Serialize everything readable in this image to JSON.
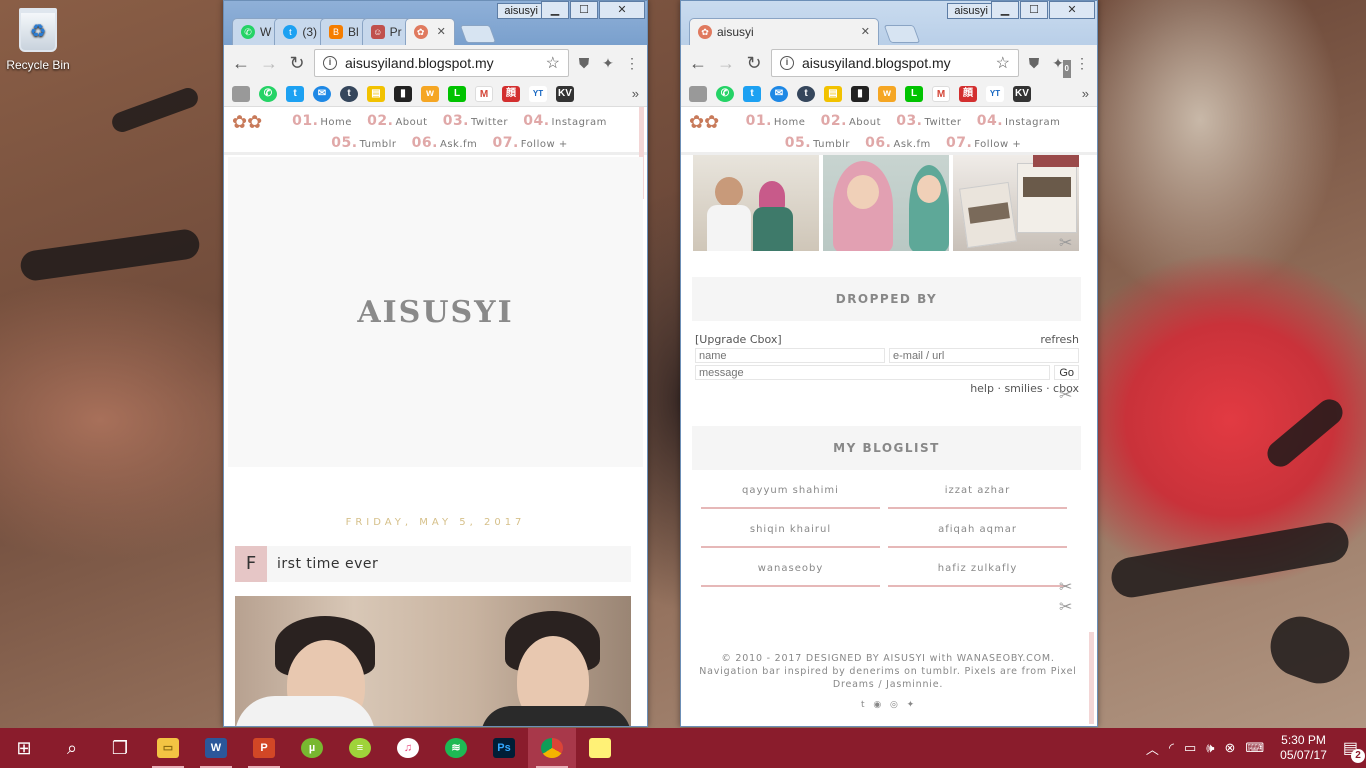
{
  "desktop": {
    "recycle_bin_label": "Recycle Bin"
  },
  "window1": {
    "profile": "aisusyi",
    "tabs": [
      {
        "label": "W",
        "icon": "whatsapp-icon",
        "color": "#25d366"
      },
      {
        "label": "(3)",
        "icon": "twitter-icon",
        "color": "#1da1f2"
      },
      {
        "label": "Bl",
        "icon": "blogger-icon",
        "color": "#f57d00"
      },
      {
        "label": "Pr",
        "icon": "profile-icon",
        "color": "#c0504d"
      },
      {
        "label": "",
        "icon": "flower-icon",
        "color": "#e07a5f"
      }
    ],
    "url": "aisusyiland.blogspot.my"
  },
  "window2": {
    "profile": "aisusyi",
    "tab_label": "aisusyi",
    "url": "aisusyiland.blogspot.my",
    "ext_badge": "0"
  },
  "blog_nav": [
    {
      "num": "01.",
      "label": "Home"
    },
    {
      "num": "02.",
      "label": "About"
    },
    {
      "num": "03.",
      "label": "Twitter"
    },
    {
      "num": "04.",
      "label": "Instagram"
    },
    {
      "num": "05.",
      "label": "Tumblr"
    },
    {
      "num": "06.",
      "label": "Ask.fm"
    },
    {
      "num": "07.",
      "label": "Follow +"
    }
  ],
  "blog": {
    "title": "AISUSYI",
    "date": "FRIDAY, MAY 5, 2017",
    "post_cap": "F",
    "post_rest": "irst time ever"
  },
  "sidebar": {
    "dropped_by": "DROPPED BY",
    "cbox": {
      "upgrade": "[Upgrade Cbox]",
      "refresh": "refresh",
      "name_placeholder": "name",
      "email_placeholder": "e-mail / url",
      "message_placeholder": "message",
      "go": "Go",
      "links": "help · smilies · cbox"
    },
    "bloglist_title": "MY BLOGLIST",
    "bloglist": [
      "qayyum shahimi",
      "izzat azhar",
      "shiqin khairul",
      "afiqah aqmar",
      "wanaseoby",
      "hafiz zulkafly"
    ],
    "footer": "© 2010 - 2017 DESIGNED BY AISUSYI with WANASEOBY.COM. Navigation bar inspired by denerims on tumblr. Pixels are from Pixel Dreams / Jasminnie."
  },
  "taskbar": {
    "apps": [
      "file-explorer-icon",
      "word-icon",
      "powerpoint-icon",
      "utorrent-icon",
      "line-icon",
      "itunes-icon",
      "spotify-icon",
      "photoshop-icon",
      "chrome-icon",
      "sticky-notes-icon"
    ],
    "time": "5:30 PM",
    "date": "05/07/17",
    "notifications": "2"
  }
}
